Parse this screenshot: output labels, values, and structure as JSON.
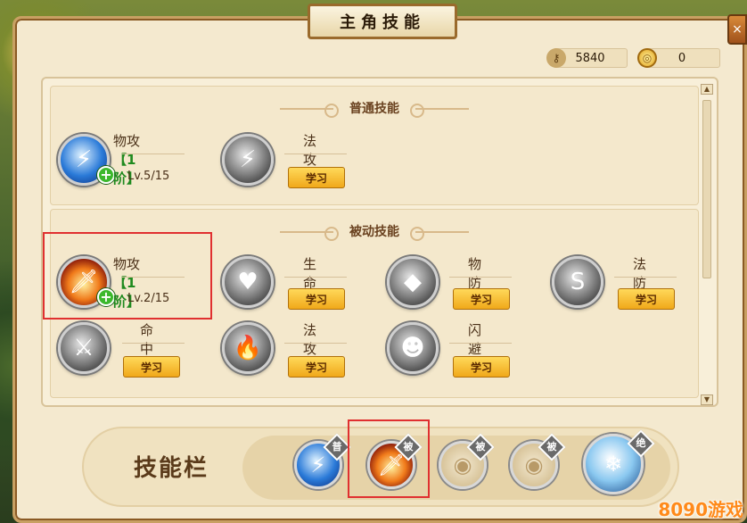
{
  "window": {
    "title": "主角技能",
    "close_glyph": "×"
  },
  "currency": {
    "key_value": "5840",
    "coin_value": "0",
    "key_icon": "key-icon",
    "coin_icon": "coin-icon"
  },
  "normal_section": {
    "title": "普通技能",
    "skills": [
      {
        "name": "物攻",
        "tier": "【1阶】",
        "level": "Lv.5/15",
        "icon": "lightning-sword-icon"
      },
      {
        "name": "法攻",
        "button": "学习",
        "icon": "lightning-icon"
      }
    ]
  },
  "passive_section": {
    "title": "被动技能",
    "skills": [
      {
        "name": "物攻",
        "tier": "【1阶】",
        "level": "Lv.2/15",
        "icon": "fire-sword-icon"
      },
      {
        "name": "生命",
        "button": "学习",
        "icon": "heart-icon"
      },
      {
        "name": "物防",
        "button": "学习",
        "icon": "shield-diamond-icon"
      },
      {
        "name": "法防",
        "button": "学习",
        "icon": "shield-s-icon"
      },
      {
        "name": "命中",
        "button": "学习",
        "icon": "sword-icon"
      },
      {
        "name": "法攻",
        "button": "学习",
        "icon": "flame-icon"
      },
      {
        "name": "闪避",
        "button": "学习",
        "icon": "ghost-icon"
      }
    ]
  },
  "skill_bar": {
    "label": "技能栏",
    "slots": [
      {
        "badge": "普",
        "icon": "lightning-sword-icon"
      },
      {
        "badge": "被",
        "icon": "fire-sword-icon"
      },
      {
        "badge": "被",
        "icon": "empty-slot-icon"
      },
      {
        "badge": "被",
        "icon": "empty-slot-icon"
      },
      {
        "badge": "绝",
        "icon": "ultimate-icon"
      }
    ]
  },
  "watermark": "8090游戏"
}
